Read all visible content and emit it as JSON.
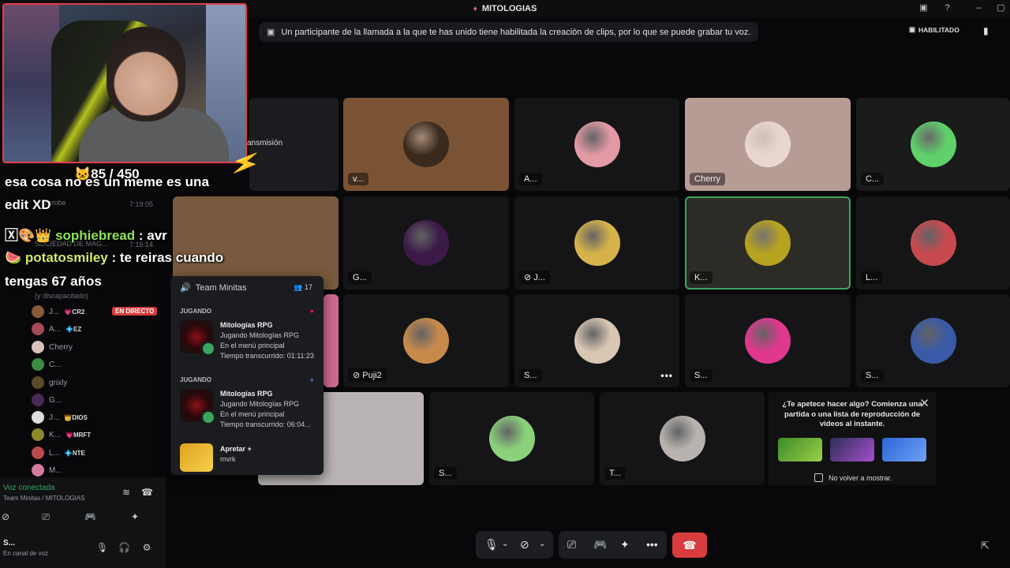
{
  "window": {
    "title": "MITOLOGIAS"
  },
  "notice": {
    "text": "Un participante de la llamada a la que te has unido tiene habilitada la creación de clips, por lo que se puede grabar tu voz.",
    "badge": "HABILITADO"
  },
  "overlay": {
    "counter": "🐱85 / 450",
    "stream_fragment": "ansmisión",
    "chat": [
      {
        "user": "",
        "text": "esa cosa no es un meme es una"
      },
      {
        "user": "",
        "text": "edit XD"
      },
      {
        "user": "sophiebread",
        "text": " : avr"
      },
      {
        "user": "potatosmiley",
        "text": " : te reiras cuando"
      },
      {
        "user": "",
        "text": "tengas 67 años"
      }
    ],
    "dim_texts": [
      "a Mambe",
      "7:19:05",
      "SOCIEDAD DE MAG...",
      "7:16:14",
      "(y discapacitado)"
    ]
  },
  "tiles": [
    {
      "name": "v...",
      "bg": "#7a5335",
      "av": "#3a2a1e"
    },
    {
      "name": "A...",
      "bg": "#151517",
      "av": "#e39aa5"
    },
    {
      "name": "Cherry",
      "bg": "#b79c96",
      "av": "#e8d6cf"
    },
    {
      "name": "C...",
      "bg": "#1a1c1b",
      "av": "#5fd06a"
    },
    {
      "name": "G...",
      "bg": "#151517",
      "av": "#3b1a48"
    },
    {
      "name": "J...",
      "bg": "#151517",
      "av": "#d6b34a"
    },
    {
      "name": "K...",
      "bg": "#2d2b26",
      "av": "#b8a320"
    },
    {
      "name": "L...",
      "bg": "#151517",
      "av": "#c84a4e"
    },
    {
      "name": "Puji2",
      "bg": "#151517",
      "av": "#c88a4a"
    },
    {
      "name": "S...",
      "bg": "#151517",
      "av": "#d9c6b3"
    },
    {
      "name": "S...",
      "bg": "#151517",
      "av": "#e0388e"
    },
    {
      "name": "S...",
      "bg": "#151517",
      "av": "#3a5aa8"
    },
    {
      "name": "S...",
      "bg": "#151517",
      "av": "#8bd07a"
    },
    {
      "name": "T...",
      "bg": "#151517",
      "av": "#b8b3ae"
    }
  ],
  "sidebar": {
    "live_label": "EN DIRECTO",
    "members": [
      {
        "name": "J...",
        "tag": "💗CR2"
      },
      {
        "name": "A...",
        "tag": "💠EZ"
      },
      {
        "name": "Cherry",
        "tag": ""
      },
      {
        "name": "C...",
        "tag": ""
      },
      {
        "name": "grixly",
        "tag": ""
      },
      {
        "name": "G...",
        "tag": ""
      },
      {
        "name": "J...",
        "tag": "👑DIOS"
      },
      {
        "name": "K...",
        "tag": "💗MRFT"
      },
      {
        "name": "L...",
        "tag": "💠NTE"
      },
      {
        "name": "M...",
        "tag": ""
      }
    ]
  },
  "popup": {
    "channel": "Team Minitas",
    "count": "17",
    "section": "JUGANDO",
    "games": [
      {
        "title": "Mitologías RPG",
        "line1": "Jugando Mitologías RPG",
        "line2": "En el menú principal",
        "line3": "Tiempo transcurrido: 01:11:23"
      },
      {
        "title": "Mitologías RPG",
        "line1": "Jugando Mitologías RPG",
        "line2": "En el menú principal",
        "line3": "Tiempo transcurrido: 06:04..."
      }
    ],
    "extra": {
      "title": "Apretar +",
      "sub": "mvrk"
    }
  },
  "voice": {
    "status": "Voz conectada",
    "server": "Team Minitas / MITOLOGIAS",
    "user": "S...",
    "user_status": "En canal de voz"
  },
  "activity": {
    "text": "¿Te apetece hacer algo? Comienza una partida o una lista de reproducción de videos al instante.",
    "checkbox": "No volver a mostrar."
  }
}
